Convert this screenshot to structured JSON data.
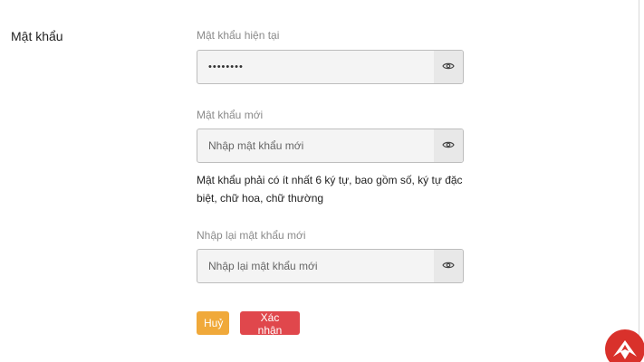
{
  "section": {
    "title": "Mật khẩu"
  },
  "current_password": {
    "label": "Mật khẩu hiện tại",
    "value": "••••••••",
    "placeholder": "",
    "icon": "eye-icon"
  },
  "new_password": {
    "label": "Mật khẩu mới",
    "value": "",
    "placeholder": "Nhập mật khẩu mới",
    "icon": "eye-icon",
    "hint": "Mật khẩu phải có ít nhất 6 ký tự, bao gồm số, ký tự đặc biệt, chữ hoa, chữ thường"
  },
  "confirm_password": {
    "label": "Nhập lại mật khẩu mới",
    "value": "",
    "placeholder": "Nhập lại mật khẩu mới",
    "icon": "eye-icon"
  },
  "actions": {
    "cancel_label": "Huỷ",
    "confirm_label": "Xác nhận"
  },
  "colors": {
    "cancel": "#f0a93a",
    "confirm": "#e0474c",
    "brand": "#d9312b"
  }
}
